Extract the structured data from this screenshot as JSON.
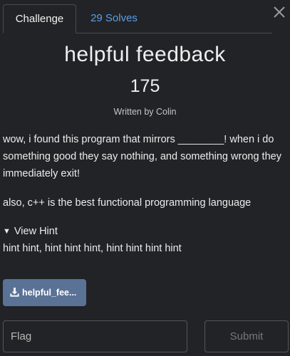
{
  "tabs": [
    {
      "label": "Challenge",
      "active": true
    },
    {
      "label": "29 Solves",
      "active": false
    }
  ],
  "challenge": {
    "name": "helpful feedback",
    "points": "175",
    "author": "Written by Colin",
    "description": "wow, i found this program that mirrors ________! when i do something good they say nothing, and something wrong they immediately exit!",
    "description2": "also, c++ is the best functional programming language"
  },
  "hint": {
    "toggle_label": "View Hint",
    "text": "hint hint, hint hint hint, hint hint hint hint"
  },
  "file": {
    "label": "helpful_fee..."
  },
  "flag_form": {
    "placeholder": "Flag",
    "value": "",
    "submit_label": "Submit"
  },
  "colors": {
    "background": "#222326",
    "link": "#5b9ee8",
    "file_button": "#5a7296"
  },
  "icons": {
    "close": "close-icon",
    "hint_toggle": "triangle-down-icon",
    "download": "download-icon"
  }
}
